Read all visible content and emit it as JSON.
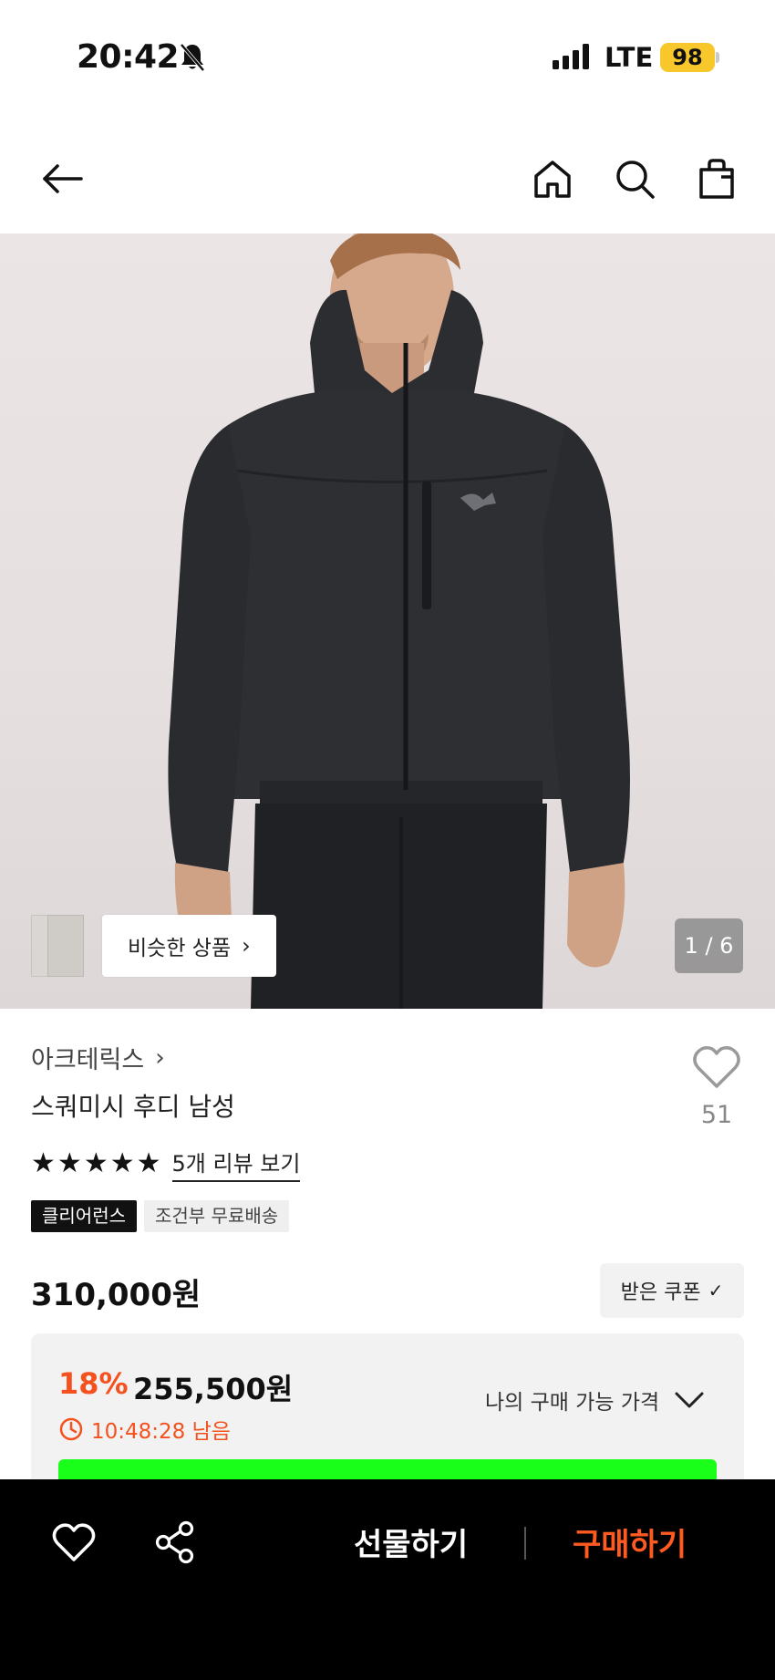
{
  "status_bar": {
    "time": "20:42",
    "network": "LTE",
    "battery": "98"
  },
  "nav": {
    "back_icon": "arrow-left-icon",
    "home_icon": "home-icon",
    "search_icon": "search-icon",
    "bag_icon": "shopping-bag-icon"
  },
  "hero": {
    "similar_label": "비슷한 상품",
    "image_counter": "1 / 6"
  },
  "product": {
    "brand": "아크테릭스",
    "name": "스쿼미시 후디 남성",
    "wish_count": "51",
    "rating_stars": 5,
    "review_link": "5개 리뷰 보기",
    "tags": [
      "클리어런스",
      "조건부 무료배송"
    ],
    "price": "310,000원",
    "coupon_label": "받은 쿠폰"
  },
  "deal": {
    "discount": "18%",
    "price": "255,500원",
    "timer": "10:48:28 남음",
    "my_price_label": "나의 구매 가능 가격"
  },
  "bottom_bar": {
    "gift_label": "선물하기",
    "buy_label": "구매하기"
  },
  "colors": {
    "accent": "#f4511e",
    "buy": "#ff5a1f",
    "battery": "#f7c72b",
    "banner": "#19ff19"
  }
}
